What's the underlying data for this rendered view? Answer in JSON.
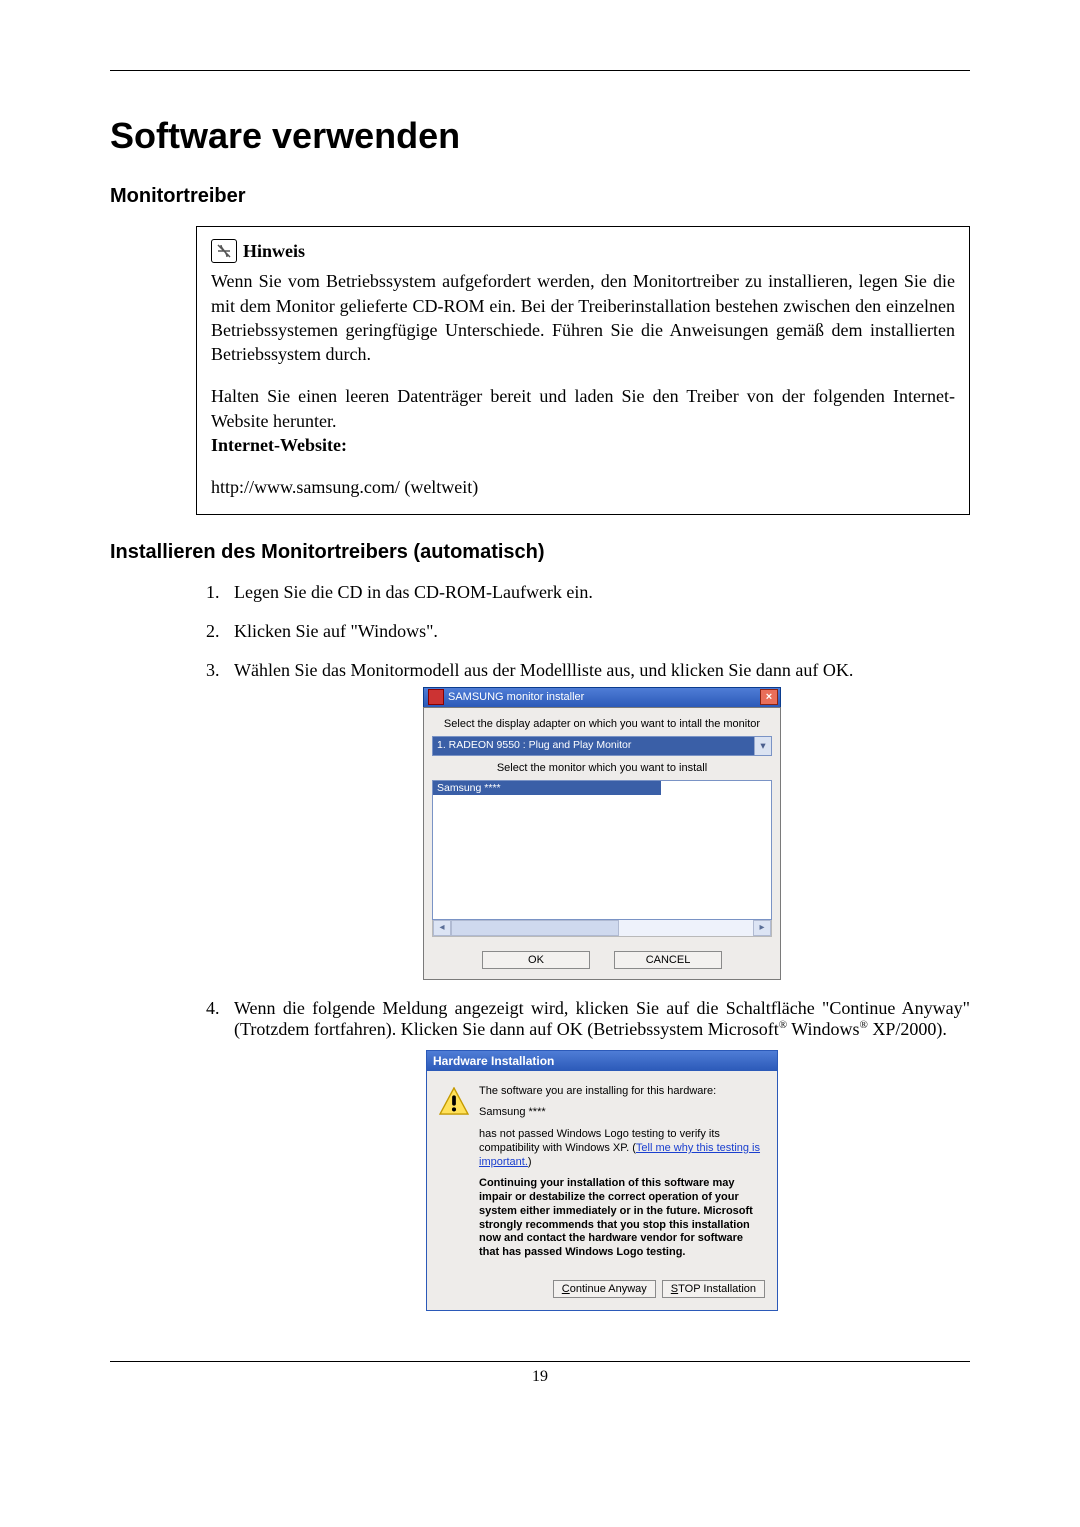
{
  "page_title": "Software verwenden",
  "section1": "Monitortreiber",
  "note": {
    "label": "Hinweis",
    "p1": "Wenn Sie vom Betriebssystem aufgefordert werden, den Monitortreiber zu installieren, legen Sie die mit dem Monitor gelieferte CD-ROM ein. Bei der Treiberinstallation bestehen zwischen den einzelnen Betriebssystemen geringfügige Unterschiede. Führen Sie die Anweisungen gemäß dem installierten Betriebssystem durch.",
    "p2": "Halten Sie einen leeren Datenträger bereit und laden Sie den Treiber von der folgenden Internet-Website herunter.",
    "label_site": "Internet-Website:",
    "url": "http://www.samsung.com/ (weltweit)"
  },
  "section2": "Installieren des Monitortreibers (automatisch)",
  "steps": {
    "s1": "Legen Sie die CD in das CD-ROM-Laufwerk ein.",
    "s2": "Klicken Sie auf \"Windows\".",
    "s3": "Wählen Sie das Monitormodell aus der Modellliste aus, und klicken Sie dann auf OK.",
    "s4a": "Wenn die folgende Meldung angezeigt wird, klicken Sie auf die Schaltfläche \"Continue Anyway\" (Trotzdem fortfahren). Klicken Sie dann auf OK (Betriebssystem Microsoft",
    "s4b": " Windows",
    "s4c": " XP/2000)."
  },
  "installer": {
    "title": "SAMSUNG monitor installer",
    "label1": "Select the display adapter on which you want to intall the monitor",
    "dropdown": "1. RADEON 9550 : Plug and Play Monitor",
    "label2": "Select the monitor which you want to install",
    "selected": "Samsung ****",
    "ok": "OK",
    "cancel": "CANCEL"
  },
  "hw": {
    "title": "Hardware Installation",
    "line1": "The software you are installing for this hardware:",
    "line2": "Samsung ****",
    "line3a": "has not passed Windows Logo testing to verify its compatibility with Windows XP. (",
    "link": "Tell me why this testing is important.",
    "line3b": ")",
    "bold": "Continuing your installation of this software may impair or destabilize the correct operation of your system either immediately or in the future. Microsoft strongly recommends that you stop this installation now and contact the hardware vendor for software that has passed Windows Logo testing.",
    "btn_continue_u": "C",
    "btn_continue_rest": "ontinue Anyway",
    "btn_stop_u": "S",
    "btn_stop_rest": "TOP Installation"
  },
  "page_number": "19"
}
